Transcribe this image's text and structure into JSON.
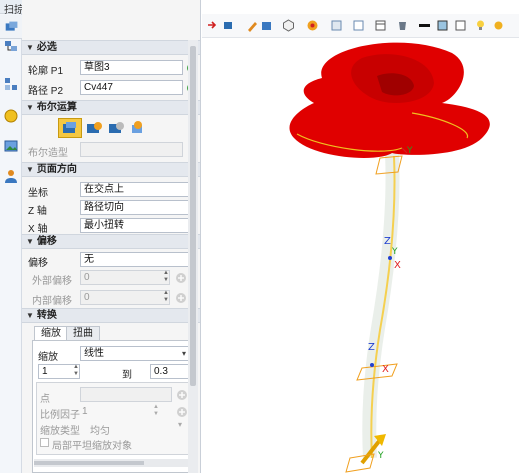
{
  "window": {
    "title": "扫掠"
  },
  "sections": {
    "required": "必选",
    "boolean": "布尔运算",
    "orientation": "页面方向",
    "offset": "偏移",
    "transform": "转换"
  },
  "required": {
    "profile_label": "轮廓 P1",
    "profile_value": "草图3",
    "path_label": "路径 P2",
    "path_value": "Cv447"
  },
  "boolean": {
    "shape_label": "布尔造型"
  },
  "orientation": {
    "coord_label": "坐标",
    "coord_value": "在交点上",
    "z_label": "Z 轴",
    "z_value": "路径切向",
    "x_label": "X 轴",
    "x_value": "最小扭转"
  },
  "offset": {
    "offset_label": "偏移",
    "offset_value": "无",
    "outer_label": "外部偏移",
    "outer_value": "0",
    "inner_label": "内部偏移",
    "inner_value": "0"
  },
  "transform": {
    "tabs": [
      "缩放",
      "扭曲"
    ],
    "scale_label": "缩放",
    "scale_value": "线性",
    "from_value": "1",
    "to_label": "到",
    "to_value": "0.3",
    "point_label": "点",
    "ratio_label": "比例因子",
    "ratio_value": "1",
    "scale_type_label": "缩放类型",
    "scale_type_value": "均匀",
    "checkbox_label": "局部平坦缩放对象"
  },
  "colors": {
    "accent": "#2b6cb0",
    "ok": "#2e9e2e",
    "cancel": "#d02020",
    "petal": "#e00000",
    "axis_x": "#e02020",
    "axis_y": "#20a020",
    "axis_z": "#2040d0"
  }
}
